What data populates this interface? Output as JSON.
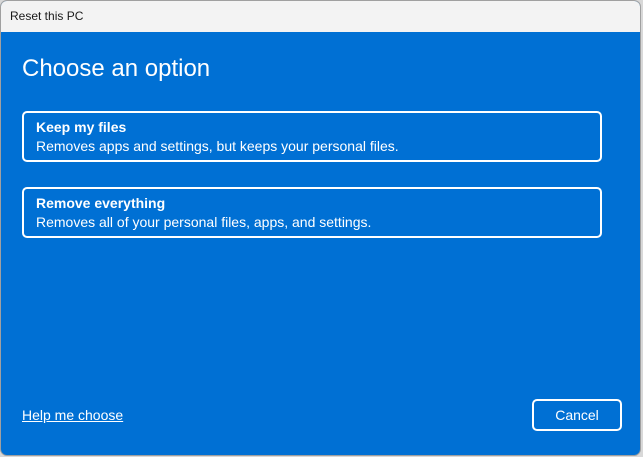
{
  "window": {
    "title": "Reset this PC"
  },
  "heading": "Choose an option",
  "options": [
    {
      "title": "Keep my files",
      "description": "Removes apps and settings, but keeps your personal files."
    },
    {
      "title": "Remove everything",
      "description": "Removes all of your personal files, apps, and settings."
    }
  ],
  "footer": {
    "help_link": "Help me choose",
    "cancel_label": "Cancel"
  },
  "colors": {
    "accent": "#0070d4",
    "titlebar": "#f3f3f3"
  }
}
